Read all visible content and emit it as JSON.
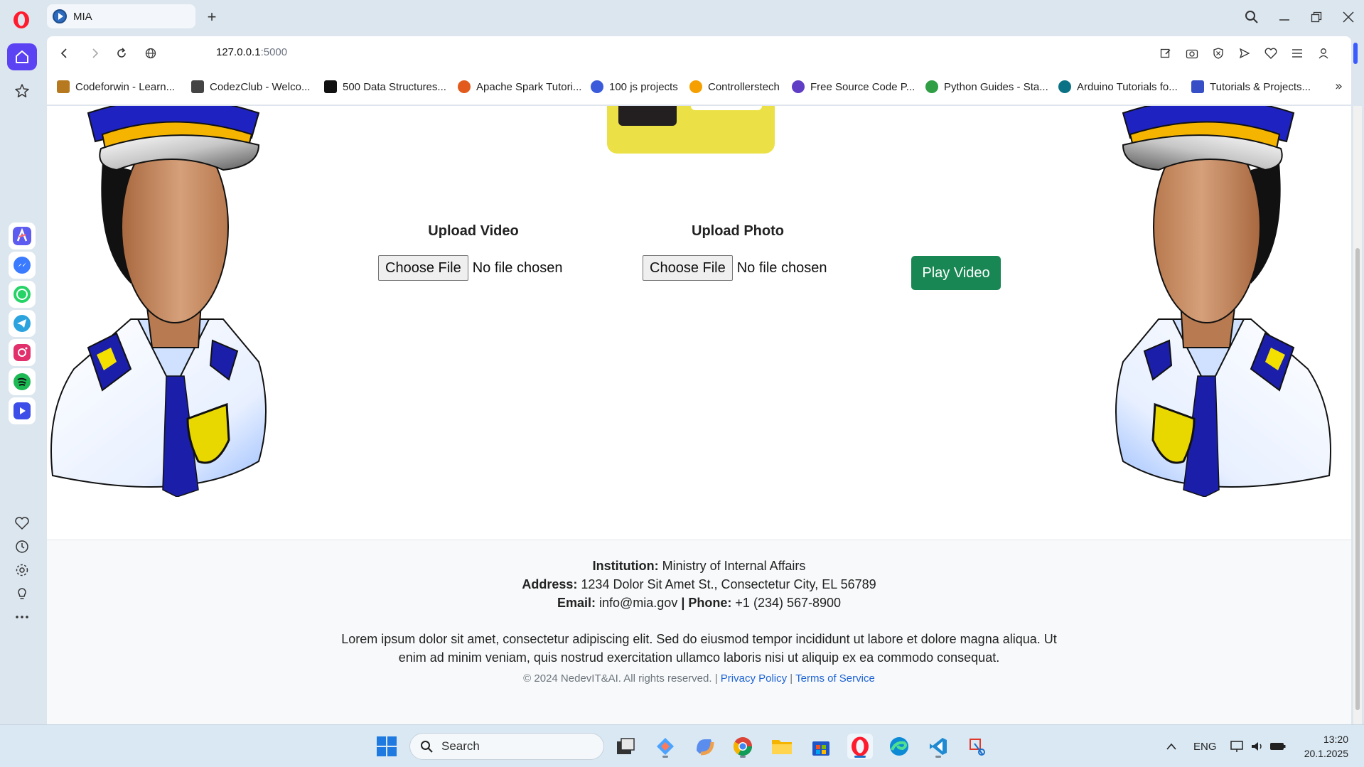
{
  "browser": {
    "tab": {
      "title": "MIA"
    },
    "new_tab_label": "+",
    "address": {
      "host": "127.0.0.1",
      "port": ":5000"
    },
    "bookmarks": [
      {
        "label": "Codeforwin - Learn...",
        "color": "#b7791f"
      },
      {
        "label": "CodezClub - Welco...",
        "color": "#444444"
      },
      {
        "label": "500 Data Structures...",
        "color": "#111111"
      },
      {
        "label": "Apache Spark Tutori...",
        "color": "#e25a1c"
      },
      {
        "label": "100 js projects",
        "color": "#3b5bdb"
      },
      {
        "label": "Controllerstech",
        "color": "#f59f00"
      },
      {
        "label": "Free Source Code P...",
        "color": "#5f3dc4"
      },
      {
        "label": "Python Guides - Sta...",
        "color": "#2f9e44"
      },
      {
        "label": "Arduino Tutorials fo...",
        "color": "#0b7285"
      },
      {
        "label": "Tutorials & Projects...",
        "color": "#364fc7"
      }
    ],
    "bookmarks_more": "»"
  },
  "page": {
    "upload_video": {
      "title": "Upload Video",
      "button": "Choose File",
      "status": "No file chosen"
    },
    "upload_photo": {
      "title": "Upload Photo",
      "button": "Choose File",
      "status": "No file chosen"
    },
    "play_button": "Play Video",
    "colors": {
      "play": "#198754",
      "banner": "#ebe146"
    }
  },
  "footer": {
    "institution_label": "Institution:",
    "institution": "Ministry of Internal Affairs",
    "address_label": "Address:",
    "address": "1234 Dolor Sit Amet St., Consectetur City, EL 56789",
    "email_label": "Email:",
    "email": "info@mia.gov",
    "separator": "|",
    "phone_label": "Phone:",
    "phone": "+1 (234) 567-8900",
    "description": "Lorem ipsum dolor sit amet, consectetur adipiscing elit. Sed do eiusmod tempor incididunt ut labore et dolore magna aliqua. Ut enim ad minim veniam, quis nostrud exercitation ullamco laboris nisi ut aliquip ex ea commodo consequat.",
    "copyright": "© 2024 NedevIT&AI. All rights reserved.",
    "privacy": "Privacy Policy",
    "terms": "Terms of Service"
  },
  "taskbar": {
    "search_placeholder": "Search",
    "language": "ENG",
    "time": "13:20",
    "date": "20.1.2025"
  }
}
